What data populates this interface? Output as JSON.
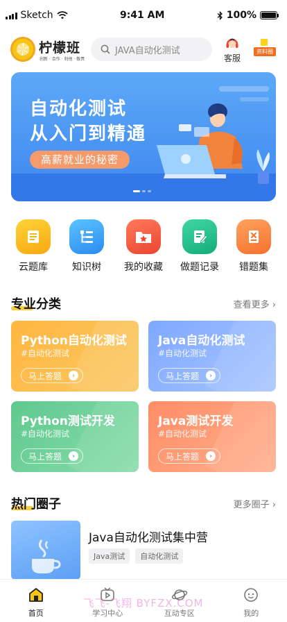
{
  "status_bar": {
    "carrier": "Sketch",
    "time": "9:41 AM",
    "battery": "100%"
  },
  "header": {
    "logo_title": "柠檬班",
    "logo_subtitle": "创新 · 合作 · 利他 · 敬畏",
    "search_placeholder": "JAVA自动化测试",
    "service_label": "客服",
    "materials_label": "资料圈"
  },
  "banner": {
    "title_line1": "自动化测试",
    "title_line2": "从入门到精通",
    "pill": "高薪就业的秘密",
    "page_index": 1,
    "page_count": 3
  },
  "shortcuts": [
    {
      "label": "云题库",
      "icon": "question-bank-icon",
      "color": "#f7b517"
    },
    {
      "label": "知识树",
      "icon": "knowledge-tree-icon",
      "color": "#3ba3f5"
    },
    {
      "label": "我的收藏",
      "icon": "favorites-folder-icon",
      "color": "#f2593d"
    },
    {
      "label": "做题记录",
      "icon": "practice-record-icon",
      "color": "#1fbf8b"
    },
    {
      "label": "错题集",
      "icon": "wrong-questions-icon",
      "color": "#f7803a"
    }
  ],
  "categories": {
    "title": "专业分类",
    "more": "查看更多",
    "cards": [
      {
        "title": "Python自动化测试",
        "subtitle": "#自动化测试",
        "button": "马上答题"
      },
      {
        "title": "Java自动化测试",
        "subtitle": "#自动化测试",
        "button": "马上答题"
      },
      {
        "title": "Python测试开发",
        "subtitle": "#自动化测试",
        "button": "马上答题"
      },
      {
        "title": "Java测试开发",
        "subtitle": "#自动化测试",
        "button": "马上答题"
      }
    ]
  },
  "hot_circles": {
    "title": "热门圈子",
    "more": "更多圈子",
    "items": [
      {
        "name": "Java自动化测试集中营",
        "tags": [
          "Java测试",
          "自动化测试"
        ]
      }
    ]
  },
  "tabbar": [
    {
      "label": "首页",
      "icon": "home-icon",
      "active": true
    },
    {
      "label": "学习中心",
      "icon": "video-play-icon",
      "active": false
    },
    {
      "label": "互动专区",
      "icon": "planet-icon",
      "active": false
    },
    {
      "label": "我的",
      "icon": "profile-face-icon",
      "active": false
    }
  ],
  "watermark": "飞飞-飞翔 BYFZX.COM"
}
